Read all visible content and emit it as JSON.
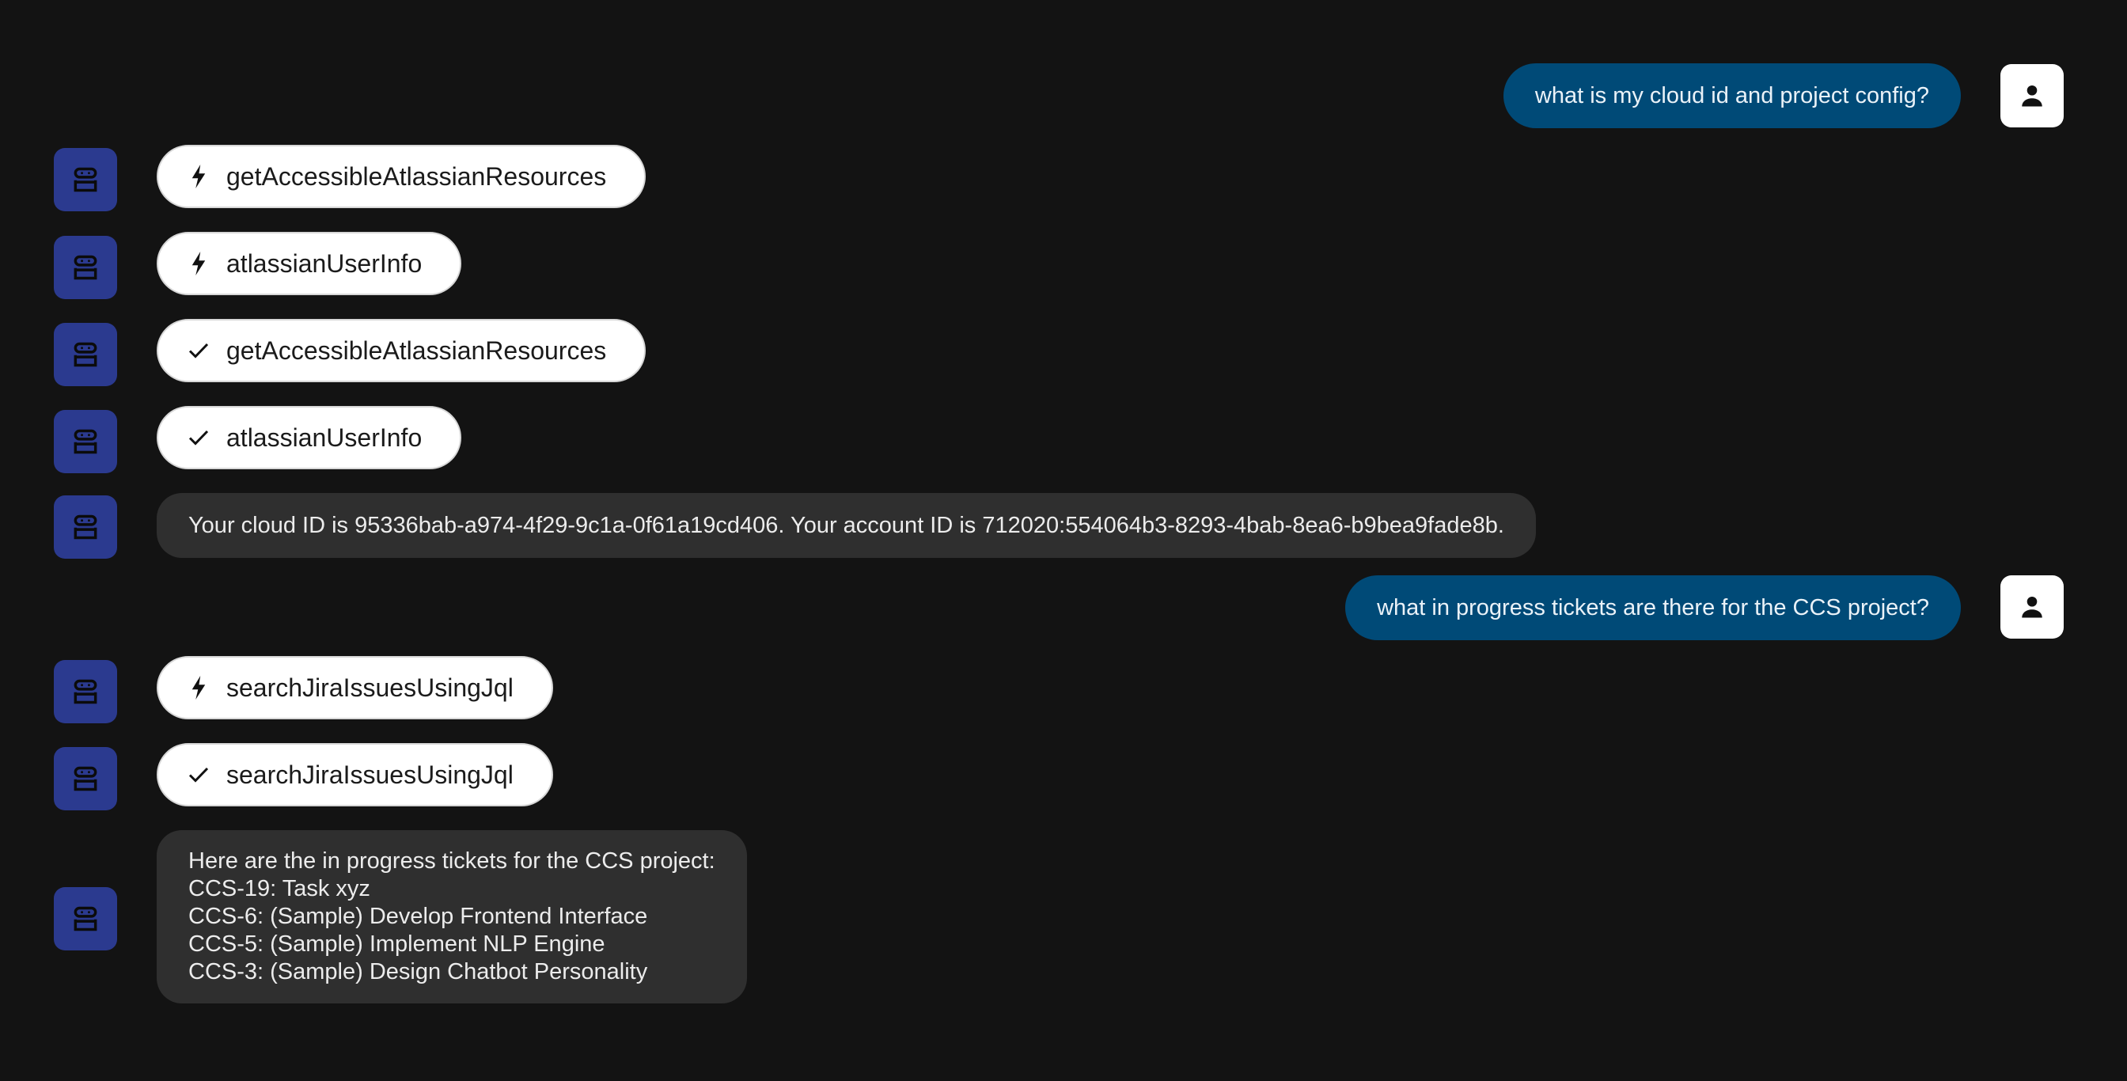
{
  "conversation": {
    "user_message_1": "what is my cloud id and project config?",
    "tool_call_1": {
      "status": "running",
      "icon": "bolt-icon",
      "label": "getAccessibleAtlassianResources"
    },
    "tool_call_2": {
      "status": "running",
      "icon": "bolt-icon",
      "label": "atlassianUserInfo"
    },
    "tool_call_3": {
      "status": "done",
      "icon": "check-icon",
      "label": "getAccessibleAtlassianResources"
    },
    "tool_call_4": {
      "status": "done",
      "icon": "check-icon",
      "label": "atlassianUserInfo"
    },
    "bot_reply_1": "Your cloud ID is 95336bab-a974-4f29-9c1a-0f61a19cd406. Your account ID is 712020:554064b3-8293-4bab-8ea6-b9bea9fade8b.",
    "user_message_2": "what in progress tickets are there for the CCS project?",
    "tool_call_5": {
      "status": "running",
      "icon": "bolt-icon",
      "label": "searchJiraIssuesUsingJql"
    },
    "tool_call_6": {
      "status": "done",
      "icon": "check-icon",
      "label": "searchJiraIssuesUsingJql"
    },
    "bot_reply_2": {
      "lines": [
        "Here are the in progress tickets for the CCS project:",
        "CCS-19: Task xyz",
        "CCS-6: (Sample) Develop Frontend Interface",
        "CCS-5: (Sample) Implement NLP Engine",
        "CCS-3: (Sample) Design Chatbot Personality"
      ]
    }
  },
  "colors": {
    "background": "#131313",
    "bot_avatar": "#2b3a8f",
    "user_bubble": "#004a77",
    "bot_bubble": "#2f2f2f",
    "chip": "#ffffff"
  }
}
